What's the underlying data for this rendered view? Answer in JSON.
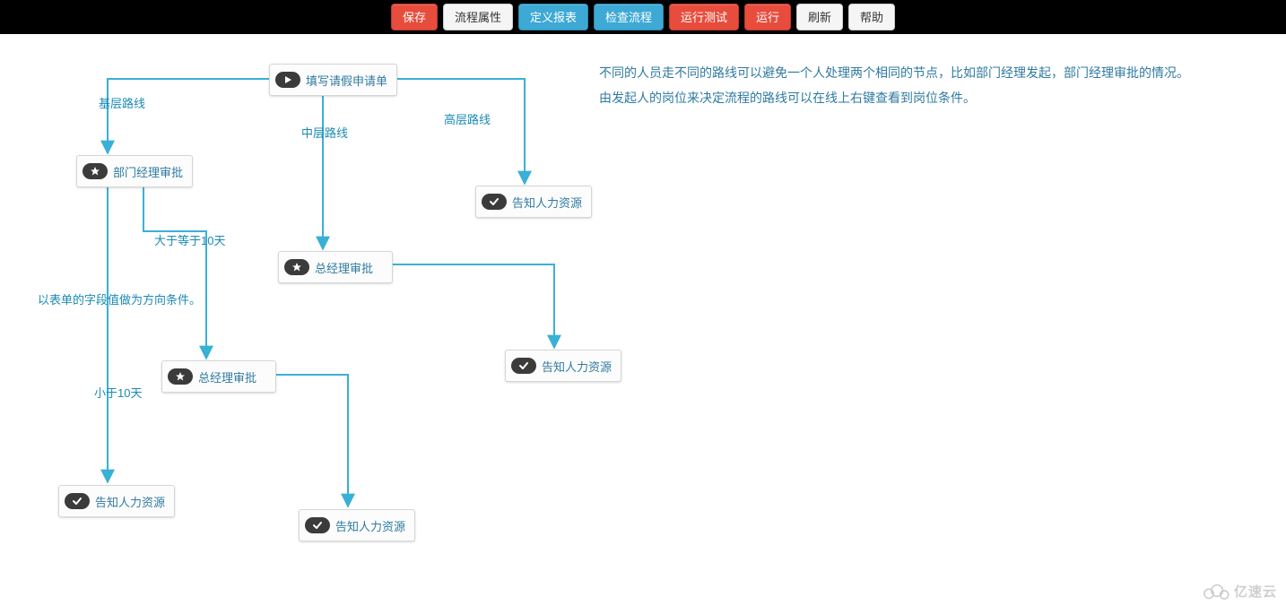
{
  "toolbar": {
    "save": "保存",
    "flow_props": "流程属性",
    "define_report": "定义报表",
    "check_flow": "检查流程",
    "run_test": "运行测试",
    "run": "运行",
    "refresh": "刷新",
    "help": "帮助"
  },
  "description": {
    "line1": "不同的人员走不同的路线可以避免一个人处理两个相同的节点，比如部门经理发起，部门经理审批的情况。",
    "line2": "由发起人的岗位来决定流程的路线可以在线上右键查看到岗位条件。"
  },
  "nodes": {
    "start": "填写请假申请单",
    "dept": "部门经理审批",
    "hr_top": "告知人力资源",
    "gm1": "总经理审批",
    "gm2": "总经理审批",
    "hr_mid": "告知人力资源",
    "hr_left": "告知人力资源",
    "hr_bot": "告知人力资源"
  },
  "edges": {
    "low_route": "基层路线",
    "mid_route": "中层路线",
    "high_route": "高层路线",
    "gte10": "大于等于10天",
    "lt10": "小于10天",
    "form_note": "以表单的字段值做为方向条件。"
  },
  "watermark": "亿速云",
  "chart_data": {
    "type": "flowchart",
    "nodes": [
      {
        "id": "start",
        "kind": "start",
        "label": "填写请假申请单"
      },
      {
        "id": "dept",
        "kind": "task",
        "label": "部门经理审批"
      },
      {
        "id": "hr_top",
        "kind": "end",
        "label": "告知人力资源"
      },
      {
        "id": "gm1",
        "kind": "task",
        "label": "总经理审批"
      },
      {
        "id": "gm2",
        "kind": "task",
        "label": "总经理审批"
      },
      {
        "id": "hr_mid",
        "kind": "end",
        "label": "告知人力资源"
      },
      {
        "id": "hr_left",
        "kind": "end",
        "label": "告知人力资源"
      },
      {
        "id": "hr_bot",
        "kind": "end",
        "label": "告知人力资源"
      }
    ],
    "edges": [
      {
        "from": "start",
        "to": "dept",
        "label": "基层路线"
      },
      {
        "from": "start",
        "to": "gm1",
        "label": "中层路线"
      },
      {
        "from": "start",
        "to": "hr_top",
        "label": "高层路线"
      },
      {
        "from": "dept",
        "to": "gm2",
        "label": "大于等于10天"
      },
      {
        "from": "dept",
        "to": "hr_left",
        "label": "小于10天"
      },
      {
        "from": "gm1",
        "to": "hr_mid",
        "label": ""
      },
      {
        "from": "gm2",
        "to": "hr_bot",
        "label": ""
      }
    ],
    "annotations": [
      {
        "text": "以表单的字段值做为方向条件。"
      }
    ]
  }
}
